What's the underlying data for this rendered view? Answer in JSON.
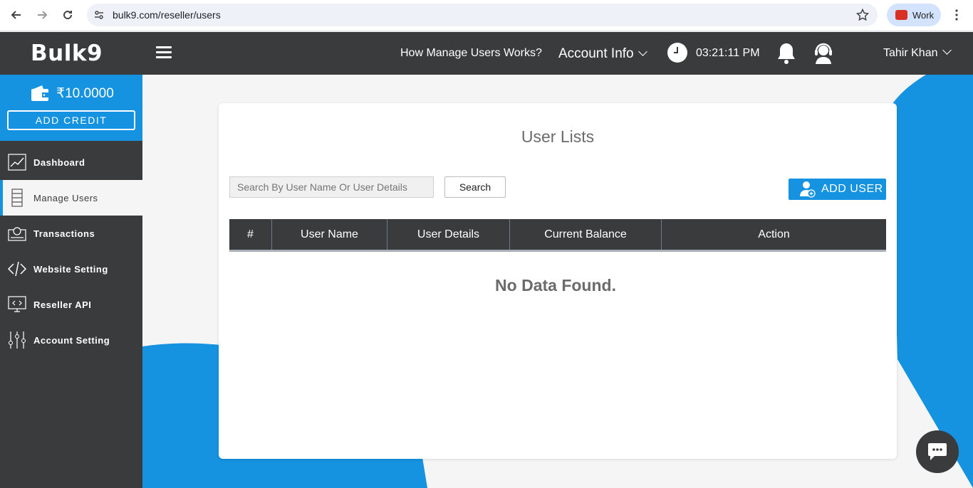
{
  "browser": {
    "url": "bulk9.com/reseller/users",
    "profile_label": "Work"
  },
  "header": {
    "logo": "Bulk9",
    "help_link": "How Manage Users Works?",
    "account_info": "Account Info",
    "time": "03:21:11 PM",
    "user_name": "Tahir Khan"
  },
  "sidebar": {
    "balance": "₹10.0000",
    "add_credit": "ADD CREDIT",
    "items": [
      {
        "label": "Dashboard",
        "icon": "chart-icon"
      },
      {
        "label": "Manage Users",
        "icon": "users-icon"
      },
      {
        "label": "Transactions",
        "icon": "transactions-icon"
      },
      {
        "label": "Website Setting",
        "icon": "code-icon"
      },
      {
        "label": "Reseller API",
        "icon": "api-icon"
      },
      {
        "label": "Account Setting",
        "icon": "sliders-icon"
      }
    ]
  },
  "main": {
    "title": "User Lists",
    "search_placeholder": "Search By User Name Or User Details",
    "search_button": "Search",
    "add_user_button": "ADD USER",
    "columns": [
      "#",
      "User Name",
      "User Details",
      "Current Balance",
      "Action"
    ],
    "empty_message": "No Data Found."
  },
  "colors": {
    "accent": "#1592e0",
    "dark": "#3a3b3d"
  }
}
